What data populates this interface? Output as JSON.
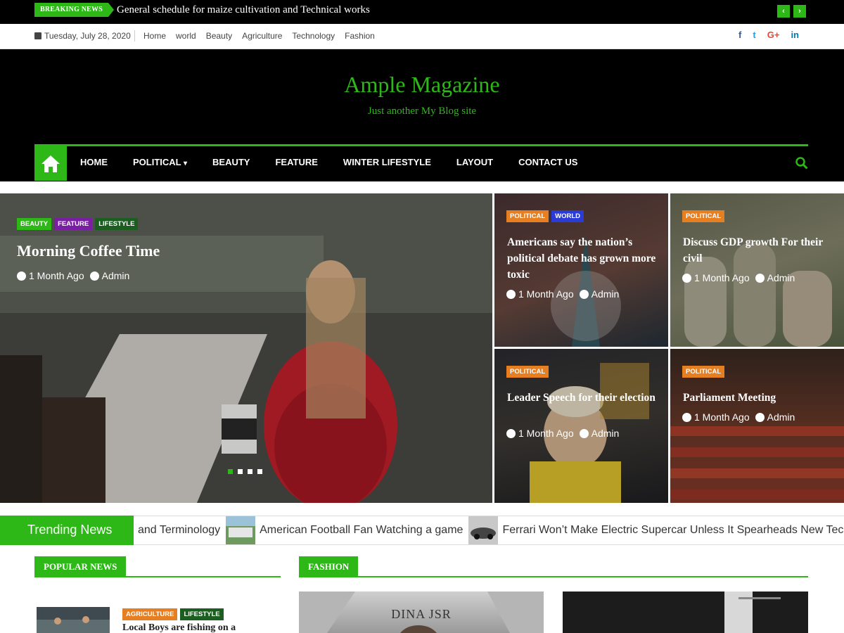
{
  "breaking": {
    "label": "BREAKING NEWS",
    "headline": "General schedule for maize cultivation and Technical works",
    "prev": "‹",
    "next": "›"
  },
  "topbar": {
    "date": "Tuesday, July 28, 2020",
    "links": [
      "Home",
      "world",
      "Beauty",
      "Agriculture",
      "Technology",
      "Fashion"
    ],
    "social": [
      {
        "icon": "facebook-icon",
        "glyph": "f",
        "color": "#3b5998"
      },
      {
        "icon": "twitter-icon",
        "glyph": "t",
        "color": "#1da1f2"
      },
      {
        "icon": "google-plus-icon",
        "glyph": "G+",
        "color": "#dd4b39"
      },
      {
        "icon": "linkedin-icon",
        "glyph": "in",
        "color": "#0077b5"
      }
    ]
  },
  "site": {
    "title": "Ample Magazine",
    "tagline": "Just another My Blog site"
  },
  "nav": {
    "items": [
      "HOME",
      "POLITICAL",
      "BEAUTY",
      "FEATURE",
      "WINTER LIFESTYLE",
      "LAYOUT",
      "CONTACT US"
    ],
    "dropdown_marker": "⌄"
  },
  "hero": {
    "tags": [
      {
        "label": "BEAUTY",
        "color": "#2db817"
      },
      {
        "label": "FEATURE",
        "color": "#7b1fa2"
      },
      {
        "label": "LIFESTYLE",
        "color": "#1b5e20"
      }
    ],
    "title": "Morning Coffee Time",
    "time": "1 Month Ago",
    "author": "Admin"
  },
  "cards": [
    {
      "tags": [
        {
          "label": "POLITICAL",
          "color": "#e67e22"
        },
        {
          "label": "WORLD",
          "color": "#2a3bd6"
        }
      ],
      "title": "Americans say the nation’s political debate has grown more toxic",
      "time": "1 Month Ago",
      "author": "Admin"
    },
    {
      "tags": [
        {
          "label": "POLITICAL",
          "color": "#e67e22"
        }
      ],
      "title": "Discuss GDP growth For their civil",
      "time": "1 Month Ago",
      "author": "Admin"
    },
    {
      "tags": [
        {
          "label": "POLITICAL",
          "color": "#e67e22"
        }
      ],
      "title": "Leader Speech for their election",
      "time": "1 Month Ago",
      "author": "Admin"
    },
    {
      "tags": [
        {
          "label": "POLITICAL",
          "color": "#e67e22"
        }
      ],
      "title": "Parliament Meeting",
      "time": "1 Month Ago",
      "author": "Admin"
    }
  ],
  "trending": {
    "label": "Trending News",
    "items": [
      "and Terminology",
      "American Football Fan Watching a game",
      "Ferrari Won’t Make Electric Supercar Unless It Spearheads New Tech"
    ]
  },
  "popular": {
    "label": "POPULAR NEWS",
    "item": {
      "tags": [
        {
          "label": "AGRICULTURE",
          "color": "#e67e22"
        },
        {
          "label": "LIFESTYLE",
          "color": "#1b5e20"
        }
      ],
      "title": "Local Boys are fishing on a"
    }
  },
  "fashion": {
    "label": "FASHION",
    "image_text": "DINA JSR"
  }
}
